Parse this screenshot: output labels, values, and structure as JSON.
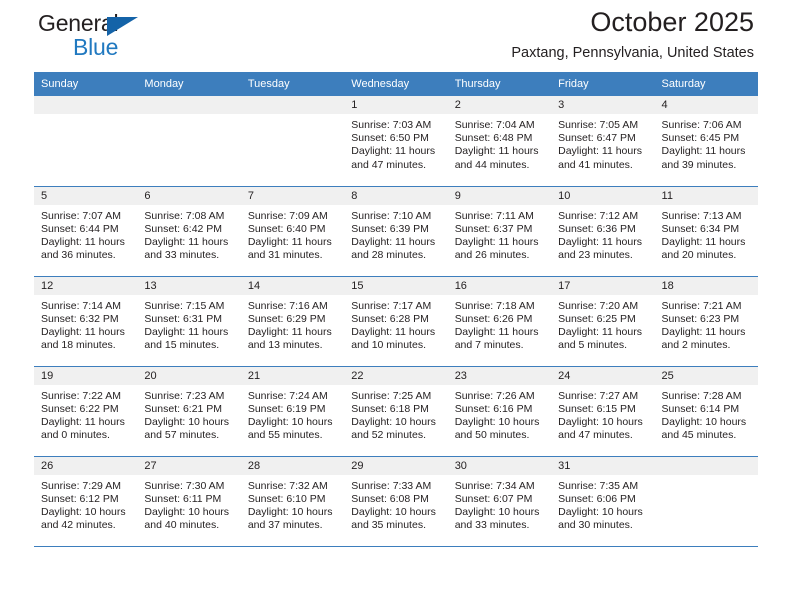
{
  "logo": {
    "word_one": "General",
    "word_two": "Blue",
    "triangle_color": "#1463a8",
    "blue_text_color": "#2179c0"
  },
  "header": {
    "title": "October 2025",
    "subtitle": "Paxtang, Pennsylvania, United States"
  },
  "colors": {
    "header_blue": "#3d7ebd",
    "daybar_gray": "#f0f0f0",
    "text": "#231f20"
  },
  "weekdays": [
    "Sunday",
    "Monday",
    "Tuesday",
    "Wednesday",
    "Thursday",
    "Friday",
    "Saturday"
  ],
  "labels": {
    "sunrise_prefix": "Sunrise:",
    "sunset_prefix": "Sunset:",
    "daylight_prefix": "Daylight:"
  },
  "weeks": [
    [
      {
        "empty": true
      },
      {
        "empty": true
      },
      {
        "empty": true
      },
      {
        "day": "1",
        "sunrise": "Sunrise: 7:03 AM",
        "sunset": "Sunset: 6:50 PM",
        "daylight_1": "Daylight: 11 hours",
        "daylight_2": "and 47 minutes."
      },
      {
        "day": "2",
        "sunrise": "Sunrise: 7:04 AM",
        "sunset": "Sunset: 6:48 PM",
        "daylight_1": "Daylight: 11 hours",
        "daylight_2": "and 44 minutes."
      },
      {
        "day": "3",
        "sunrise": "Sunrise: 7:05 AM",
        "sunset": "Sunset: 6:47 PM",
        "daylight_1": "Daylight: 11 hours",
        "daylight_2": "and 41 minutes."
      },
      {
        "day": "4",
        "sunrise": "Sunrise: 7:06 AM",
        "sunset": "Sunset: 6:45 PM",
        "daylight_1": "Daylight: 11 hours",
        "daylight_2": "and 39 minutes."
      }
    ],
    [
      {
        "day": "5",
        "sunrise": "Sunrise: 7:07 AM",
        "sunset": "Sunset: 6:44 PM",
        "daylight_1": "Daylight: 11 hours",
        "daylight_2": "and 36 minutes."
      },
      {
        "day": "6",
        "sunrise": "Sunrise: 7:08 AM",
        "sunset": "Sunset: 6:42 PM",
        "daylight_1": "Daylight: 11 hours",
        "daylight_2": "and 33 minutes."
      },
      {
        "day": "7",
        "sunrise": "Sunrise: 7:09 AM",
        "sunset": "Sunset: 6:40 PM",
        "daylight_1": "Daylight: 11 hours",
        "daylight_2": "and 31 minutes."
      },
      {
        "day": "8",
        "sunrise": "Sunrise: 7:10 AM",
        "sunset": "Sunset: 6:39 PM",
        "daylight_1": "Daylight: 11 hours",
        "daylight_2": "and 28 minutes."
      },
      {
        "day": "9",
        "sunrise": "Sunrise: 7:11 AM",
        "sunset": "Sunset: 6:37 PM",
        "daylight_1": "Daylight: 11 hours",
        "daylight_2": "and 26 minutes."
      },
      {
        "day": "10",
        "sunrise": "Sunrise: 7:12 AM",
        "sunset": "Sunset: 6:36 PM",
        "daylight_1": "Daylight: 11 hours",
        "daylight_2": "and 23 minutes."
      },
      {
        "day": "11",
        "sunrise": "Sunrise: 7:13 AM",
        "sunset": "Sunset: 6:34 PM",
        "daylight_1": "Daylight: 11 hours",
        "daylight_2": "and 20 minutes."
      }
    ],
    [
      {
        "day": "12",
        "sunrise": "Sunrise: 7:14 AM",
        "sunset": "Sunset: 6:32 PM",
        "daylight_1": "Daylight: 11 hours",
        "daylight_2": "and 18 minutes."
      },
      {
        "day": "13",
        "sunrise": "Sunrise: 7:15 AM",
        "sunset": "Sunset: 6:31 PM",
        "daylight_1": "Daylight: 11 hours",
        "daylight_2": "and 15 minutes."
      },
      {
        "day": "14",
        "sunrise": "Sunrise: 7:16 AM",
        "sunset": "Sunset: 6:29 PM",
        "daylight_1": "Daylight: 11 hours",
        "daylight_2": "and 13 minutes."
      },
      {
        "day": "15",
        "sunrise": "Sunrise: 7:17 AM",
        "sunset": "Sunset: 6:28 PM",
        "daylight_1": "Daylight: 11 hours",
        "daylight_2": "and 10 minutes."
      },
      {
        "day": "16",
        "sunrise": "Sunrise: 7:18 AM",
        "sunset": "Sunset: 6:26 PM",
        "daylight_1": "Daylight: 11 hours",
        "daylight_2": "and 7 minutes."
      },
      {
        "day": "17",
        "sunrise": "Sunrise: 7:20 AM",
        "sunset": "Sunset: 6:25 PM",
        "daylight_1": "Daylight: 11 hours",
        "daylight_2": "and 5 minutes."
      },
      {
        "day": "18",
        "sunrise": "Sunrise: 7:21 AM",
        "sunset": "Sunset: 6:23 PM",
        "daylight_1": "Daylight: 11 hours",
        "daylight_2": "and 2 minutes."
      }
    ],
    [
      {
        "day": "19",
        "sunrise": "Sunrise: 7:22 AM",
        "sunset": "Sunset: 6:22 PM",
        "daylight_1": "Daylight: 11 hours",
        "daylight_2": "and 0 minutes."
      },
      {
        "day": "20",
        "sunrise": "Sunrise: 7:23 AM",
        "sunset": "Sunset: 6:21 PM",
        "daylight_1": "Daylight: 10 hours",
        "daylight_2": "and 57 minutes."
      },
      {
        "day": "21",
        "sunrise": "Sunrise: 7:24 AM",
        "sunset": "Sunset: 6:19 PM",
        "daylight_1": "Daylight: 10 hours",
        "daylight_2": "and 55 minutes."
      },
      {
        "day": "22",
        "sunrise": "Sunrise: 7:25 AM",
        "sunset": "Sunset: 6:18 PM",
        "daylight_1": "Daylight: 10 hours",
        "daylight_2": "and 52 minutes."
      },
      {
        "day": "23",
        "sunrise": "Sunrise: 7:26 AM",
        "sunset": "Sunset: 6:16 PM",
        "daylight_1": "Daylight: 10 hours",
        "daylight_2": "and 50 minutes."
      },
      {
        "day": "24",
        "sunrise": "Sunrise: 7:27 AM",
        "sunset": "Sunset: 6:15 PM",
        "daylight_1": "Daylight: 10 hours",
        "daylight_2": "and 47 minutes."
      },
      {
        "day": "25",
        "sunrise": "Sunrise: 7:28 AM",
        "sunset": "Sunset: 6:14 PM",
        "daylight_1": "Daylight: 10 hours",
        "daylight_2": "and 45 minutes."
      }
    ],
    [
      {
        "day": "26",
        "sunrise": "Sunrise: 7:29 AM",
        "sunset": "Sunset: 6:12 PM",
        "daylight_1": "Daylight: 10 hours",
        "daylight_2": "and 42 minutes."
      },
      {
        "day": "27",
        "sunrise": "Sunrise: 7:30 AM",
        "sunset": "Sunset: 6:11 PM",
        "daylight_1": "Daylight: 10 hours",
        "daylight_2": "and 40 minutes."
      },
      {
        "day": "28",
        "sunrise": "Sunrise: 7:32 AM",
        "sunset": "Sunset: 6:10 PM",
        "daylight_1": "Daylight: 10 hours",
        "daylight_2": "and 37 minutes."
      },
      {
        "day": "29",
        "sunrise": "Sunrise: 7:33 AM",
        "sunset": "Sunset: 6:08 PM",
        "daylight_1": "Daylight: 10 hours",
        "daylight_2": "and 35 minutes."
      },
      {
        "day": "30",
        "sunrise": "Sunrise: 7:34 AM",
        "sunset": "Sunset: 6:07 PM",
        "daylight_1": "Daylight: 10 hours",
        "daylight_2": "and 33 minutes."
      },
      {
        "day": "31",
        "sunrise": "Sunrise: 7:35 AM",
        "sunset": "Sunset: 6:06 PM",
        "daylight_1": "Daylight: 10 hours",
        "daylight_2": "and 30 minutes."
      },
      {
        "empty": true
      }
    ]
  ]
}
